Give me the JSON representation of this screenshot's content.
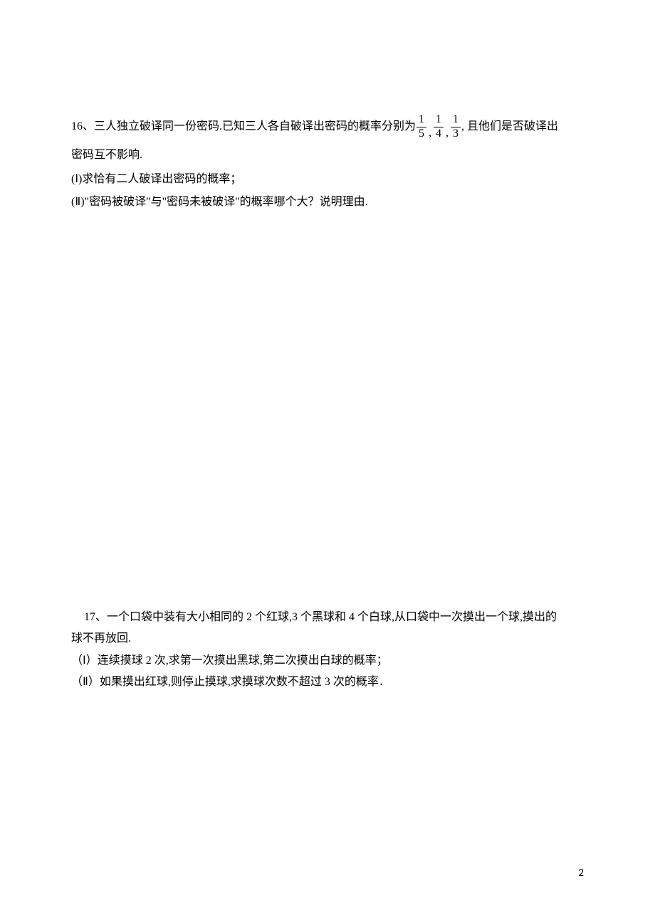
{
  "q16": {
    "line1_a": "16、三人独立破译同一份密码.已知三人各自破译出密码的概率分别为",
    "fracs": [
      {
        "num": "1",
        "den": "5"
      },
      {
        "num": "1",
        "den": "4"
      },
      {
        "num": "1",
        "den": "3"
      }
    ],
    "line1_b": ", 且他们是否破译出",
    "line2": "密码互不影响.",
    "sub1": "(Ⅰ)求恰有二人破译出密码的概率；",
    "sub2": "(Ⅱ)\"密码被破译\"与\"密码未被破译\"的概率哪个大？说明理由."
  },
  "q17": {
    "intro_a": "17、一个口袋中装有大小相同的 2 个红球,3 个黑球和 4 个白球,从口袋中一次摸出一个球,摸出的",
    "intro_b": "球不再放回.",
    "sub1": "（Ⅰ）连续摸球 2 次,求第一次摸出黑球,第二次摸出白球的概率；",
    "sub2": "（Ⅱ）如果摸出红球,则停止摸球,求摸球次数不超过 3 次的概率．"
  },
  "page_number": "2"
}
